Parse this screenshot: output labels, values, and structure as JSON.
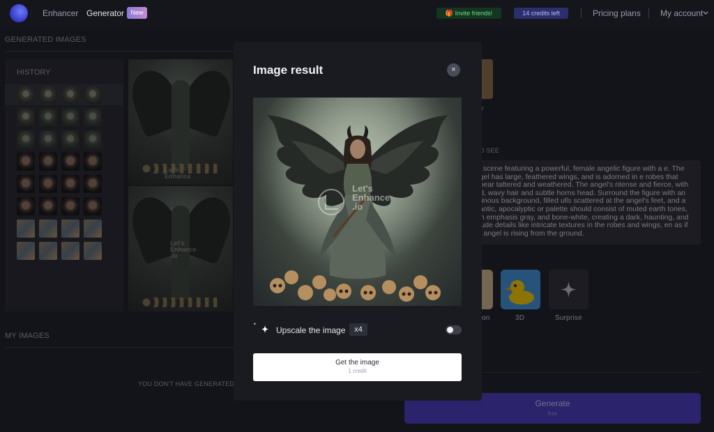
{
  "nav": {
    "enhancer": "Enhancer",
    "generator": "Generator",
    "new_badge": "New",
    "invite": "🎁 Invite friends!",
    "credits": "14 credits left",
    "pricing": "Pricing plans",
    "account": "My account"
  },
  "generated_images": {
    "heading": "GENERATED IMAGES"
  },
  "history": {
    "title": "HISTORY"
  },
  "my_images": {
    "heading": "MY IMAGES",
    "empty_text": "YOU DON'T HAVE GENERATED IM"
  },
  "right_panel": {
    "style_label_partial": "y",
    "prompt_heading_partial": "D SEE",
    "prompt_text": "eal scene featuring a powerful, female angelic figure with a e. The angel has large, feathered wings, and is adorned in e robes that appear tattered and weathered. The angel's ntense and fierce, with wild, wavy hair and subtle horns head. Surround the figure with an ominous background, filled ulls scattered at the angel's feet, and a chaotic, apocalyptic or palette should consist of muted earth tones, with emphasis gray, and bone-white, creating a dark, haunting, and nclude details like intricate textures in the robes and wings, en as if the angel is rising from the ground.",
    "styles": [
      {
        "label": "on"
      },
      {
        "label": "3D"
      },
      {
        "label": "Surprise"
      }
    ],
    "generate_label": "Generate",
    "generate_sub": "free"
  },
  "modal": {
    "title": "Image result",
    "close_symbol": "×",
    "watermark_line1": "Let's",
    "watermark_line2": "Enhance",
    "watermark_line3": ".io",
    "upscale_label": "Upscale the image",
    "upscale_factor": "x4",
    "upscale_enabled": false,
    "get_label": "Get the image",
    "get_sub": "1 credit"
  },
  "small_watermark": {
    "line1": "Let's",
    "line2": "Enhance",
    "line3": ".io"
  },
  "colors": {
    "accent": "#4638b8",
    "background": "#1b1c23",
    "modal": "#1a1b21"
  }
}
